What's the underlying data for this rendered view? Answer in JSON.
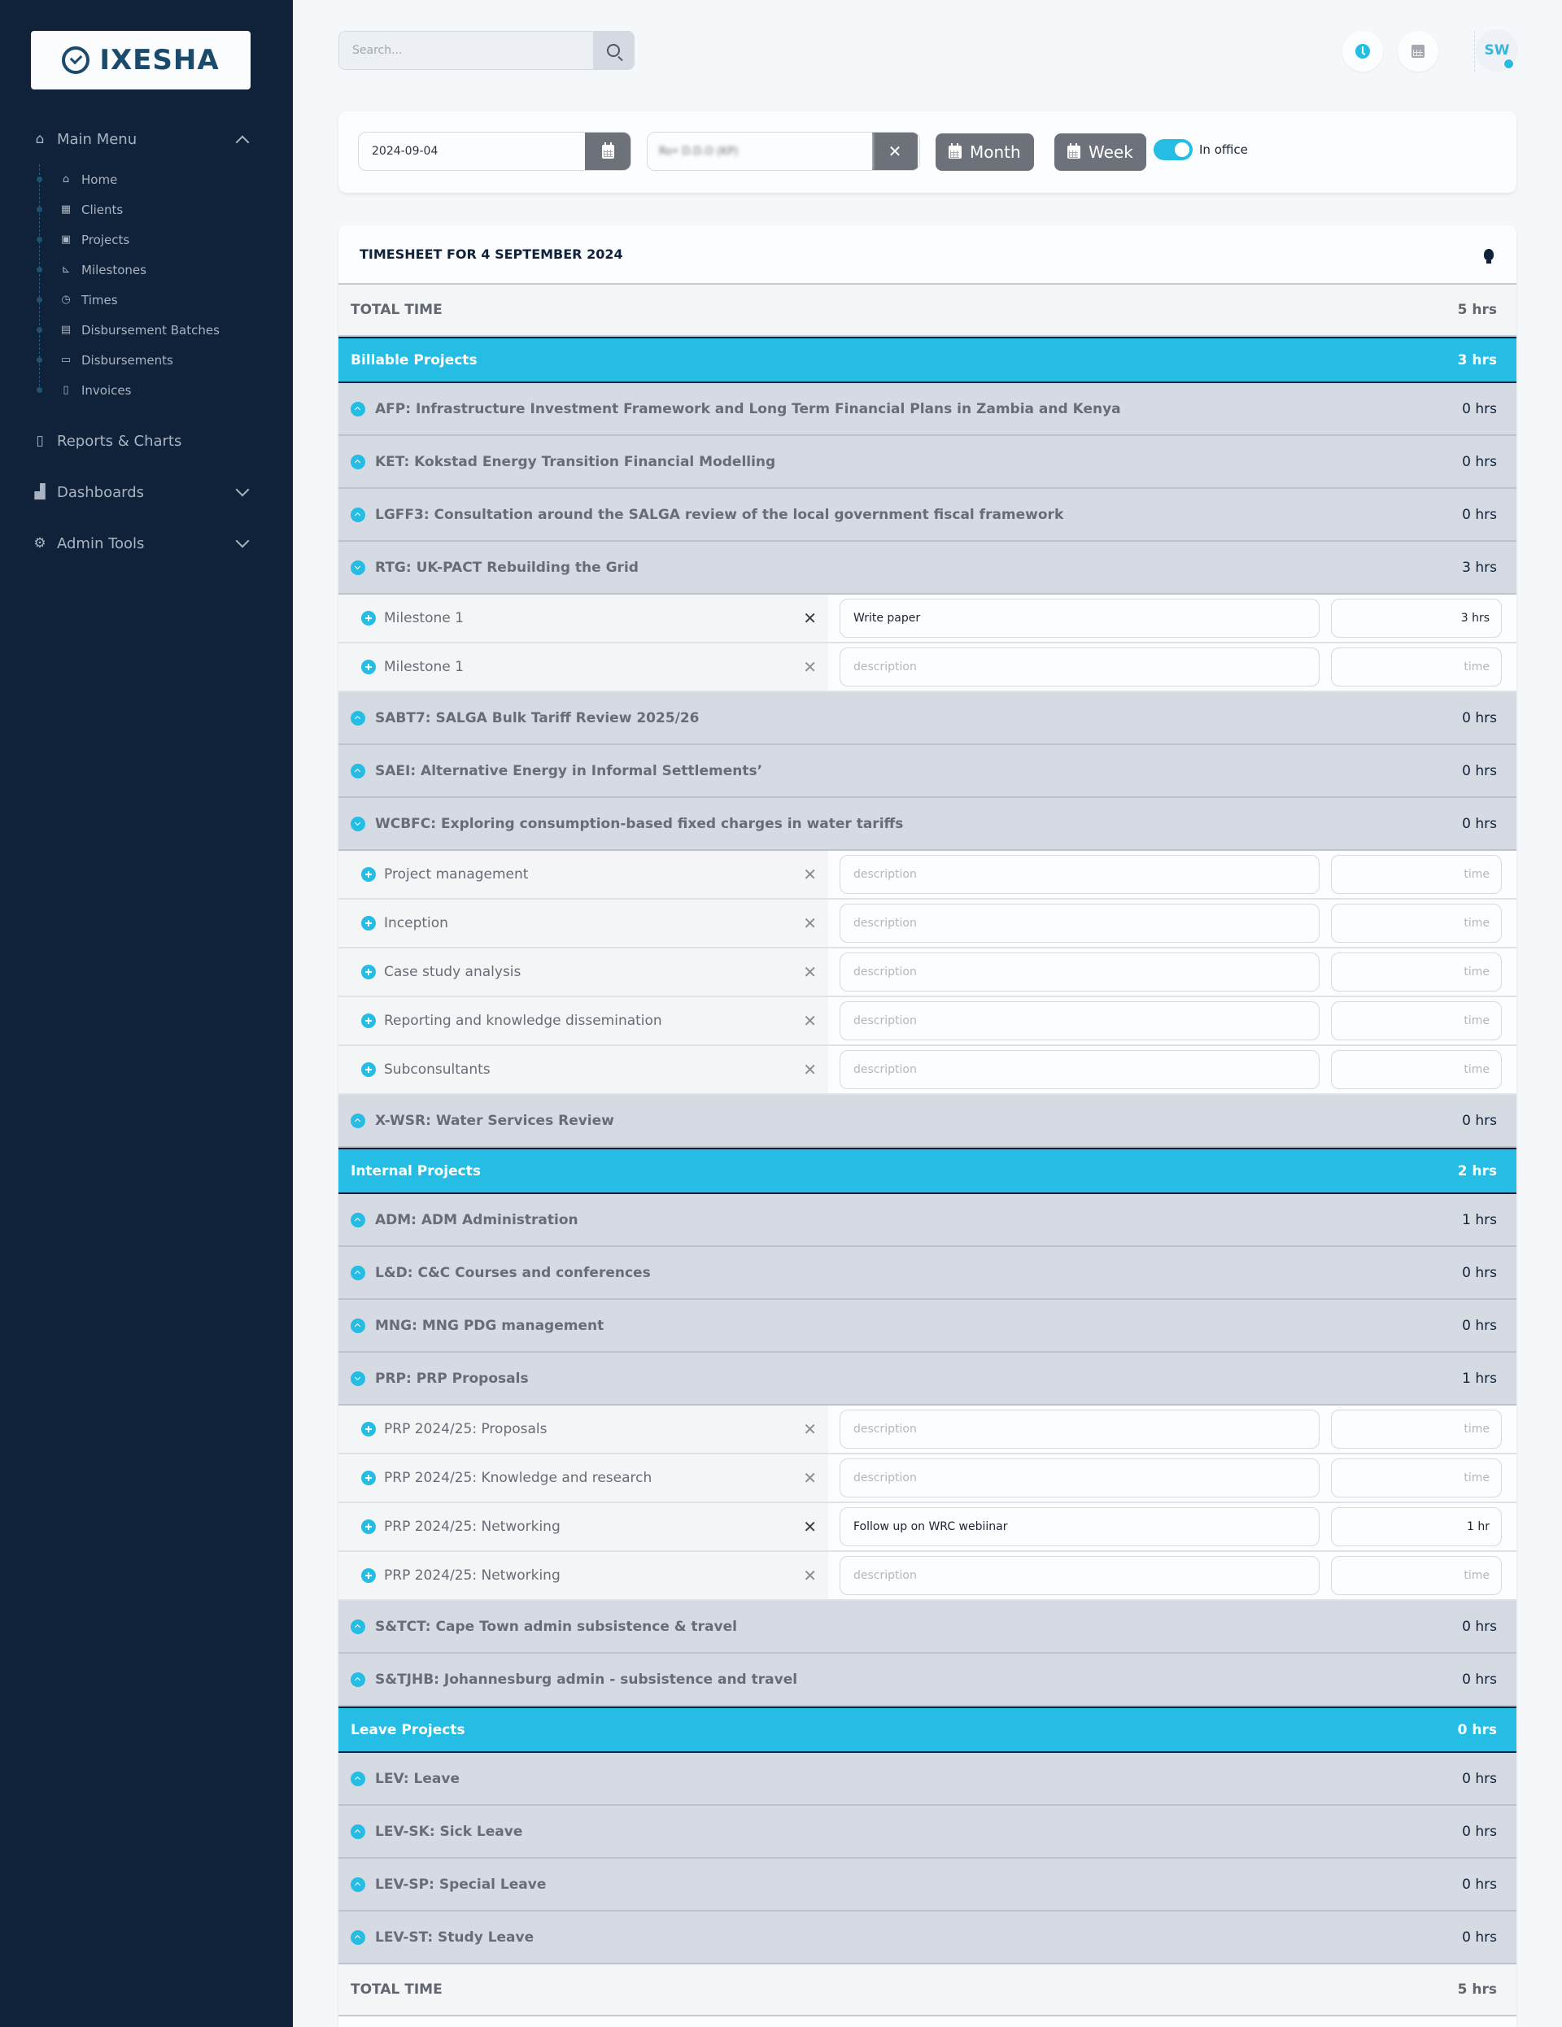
{
  "app": {
    "logo_text": "IXESHA"
  },
  "sidebar": {
    "main_menu": {
      "label": "Main Menu",
      "icon": "home-icon",
      "expanded": true
    },
    "items": [
      {
        "label": "Home",
        "icon": "home-icon",
        "glyph": "⌂"
      },
      {
        "label": "Clients",
        "icon": "building-icon",
        "glyph": "▦"
      },
      {
        "label": "Projects",
        "icon": "briefcase-icon",
        "glyph": "▣"
      },
      {
        "label": "Milestones",
        "icon": "chart-line-icon",
        "glyph": "⊾"
      },
      {
        "label": "Times",
        "icon": "clock-icon",
        "glyph": "◷"
      },
      {
        "label": "Disbursement Batches",
        "icon": "money-bills-icon",
        "glyph": "▤"
      },
      {
        "label": "Disbursements",
        "icon": "money-bill-icon",
        "glyph": "▭"
      },
      {
        "label": "Invoices",
        "icon": "file-invoice-icon",
        "glyph": "▯"
      }
    ],
    "reports": {
      "label": "Reports & Charts",
      "icon": "file-icon"
    },
    "dashboards": {
      "label": "Dashboards",
      "icon": "ranking-star-icon",
      "expanded": false
    },
    "admin_tools": {
      "label": "Admin Tools",
      "icon": "gears-icon",
      "expanded": false
    }
  },
  "topbar": {
    "search_placeholder": "Search...",
    "user_initials": "SW"
  },
  "filters": {
    "date_value": "2024-09-04",
    "user_value": "Ro• D.D.O (KP)",
    "month_label": "Month",
    "week_label": "Week",
    "in_office_label": "In office",
    "in_office_on": true
  },
  "timesheet": {
    "title": "TIMESHEET FOR 4 SEPTEMBER 2024",
    "total_label": "TOTAL TIME",
    "total_hours": "5 hrs",
    "desc_placeholder": "description",
    "time_placeholder": "time",
    "categories": [
      {
        "label": "Billable Projects",
        "hours": "3 hrs",
        "projects": [
          {
            "name": "AFP: Infrastructure Investment Framework and Long Term Financial Plans in Zambia and Kenya",
            "hours": "0 hrs",
            "expanded": false
          },
          {
            "name": "KET: Kokstad Energy Transition Financial Modelling",
            "hours": "0 hrs",
            "expanded": false
          },
          {
            "name": "LGFF3: Consultation around the SALGA review of the local government fiscal framework",
            "hours": "0 hrs",
            "expanded": false
          },
          {
            "name": "RTG: UK-PACT Rebuilding the Grid",
            "hours": "3 hrs",
            "expanded": true,
            "milestones": [
              {
                "name": "Milestone 1",
                "description": "Write paper",
                "time": "3 hrs"
              },
              {
                "name": "Milestone 1",
                "description": "",
                "time": ""
              }
            ]
          },
          {
            "name": "SABT7: SALGA Bulk Tariff Review 2025/26",
            "hours": "0 hrs",
            "expanded": false
          },
          {
            "name": "SAEI: Alternative Energy in Informal Settlements’",
            "hours": "0 hrs",
            "expanded": false
          },
          {
            "name": "WCBFC: Exploring consumption-based fixed charges in water tariffs",
            "hours": "0 hrs",
            "expanded": true,
            "milestones": [
              {
                "name": "Project management",
                "description": "",
                "time": ""
              },
              {
                "name": "Inception",
                "description": "",
                "time": ""
              },
              {
                "name": "Case study analysis",
                "description": "",
                "time": ""
              },
              {
                "name": "Reporting and knowledge dissemination",
                "description": "",
                "time": ""
              },
              {
                "name": "Subconsultants",
                "description": "",
                "time": ""
              }
            ]
          },
          {
            "name": "X-WSR: Water Services Review",
            "hours": "0 hrs",
            "expanded": false
          }
        ]
      },
      {
        "label": "Internal Projects",
        "hours": "2 hrs",
        "projects": [
          {
            "name": "ADM: ADM Administration",
            "hours": "1 hrs",
            "expanded": false
          },
          {
            "name": "L&D: C&C Courses and conferences",
            "hours": "0 hrs",
            "expanded": false
          },
          {
            "name": "MNG: MNG PDG management",
            "hours": "0 hrs",
            "expanded": false
          },
          {
            "name": "PRP: PRP Proposals",
            "hours": "1 hrs",
            "expanded": true,
            "milestones": [
              {
                "name": "PRP 2024/25: Proposals",
                "description": "",
                "time": ""
              },
              {
                "name": "PRP 2024/25: Knowledge and research",
                "description": "",
                "time": ""
              },
              {
                "name": "PRP 2024/25: Networking",
                "description": "Follow up on WRC webiinar",
                "time": "1 hr"
              },
              {
                "name": "PRP 2024/25: Networking",
                "description": "",
                "time": ""
              }
            ]
          },
          {
            "name": "S&TCT: Cape Town admin subsistence & travel",
            "hours": "0 hrs",
            "expanded": false
          },
          {
            "name": "S&TJHB: Johannesburg admin - subsistence and travel",
            "hours": "0 hrs",
            "expanded": false
          }
        ]
      },
      {
        "label": "Leave Projects",
        "hours": "0 hrs",
        "projects": [
          {
            "name": "LEV: Leave",
            "hours": "0 hrs",
            "expanded": false
          },
          {
            "name": "LEV-SK: Sick Leave",
            "hours": "0 hrs",
            "expanded": false
          },
          {
            "name": "LEV-SP: Special Leave",
            "hours": "0 hrs",
            "expanded": false
          },
          {
            "name": "LEV-ST: Study Leave",
            "hours": "0 hrs",
            "expanded": false
          }
        ]
      }
    ]
  }
}
